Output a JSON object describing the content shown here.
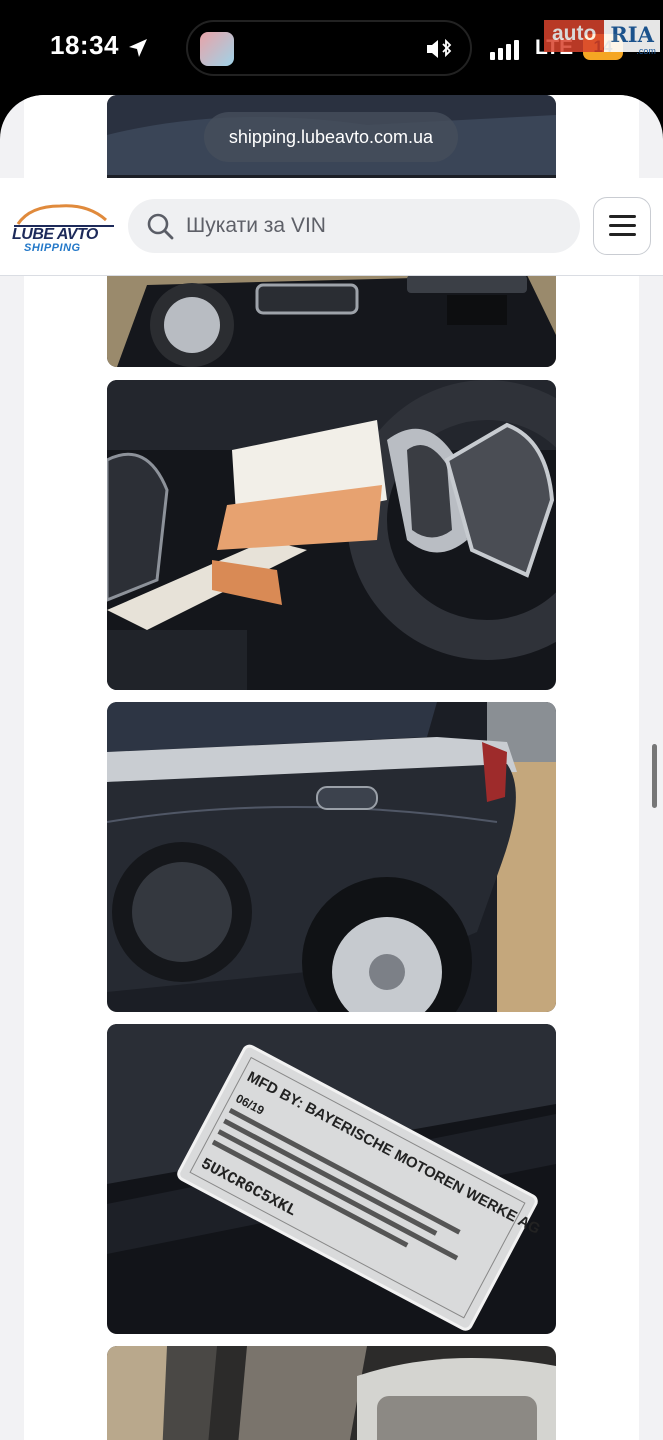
{
  "status_bar": {
    "time": "18:34",
    "network": "LTE",
    "battery": "14",
    "watermark_left": "auto",
    "watermark_right": "RIA",
    "watermark_domain": ".com"
  },
  "browser": {
    "url": "shipping.lubeavto.com.ua"
  },
  "header": {
    "logo_top": "LUBE AVTO",
    "logo_bottom": "SHIPPING",
    "search_placeholder": "Шукати за VIN"
  },
  "label_plate": {
    "line1": "MFD BY: BAYERISCHE MOTOREN WERKE AG",
    "line2": "06/19",
    "vin": "5UXCR6C5XKL"
  },
  "colors": {
    "accent": "#2378c8",
    "logo_dark": "#1d2a5a",
    "battery": "#f5a623"
  }
}
